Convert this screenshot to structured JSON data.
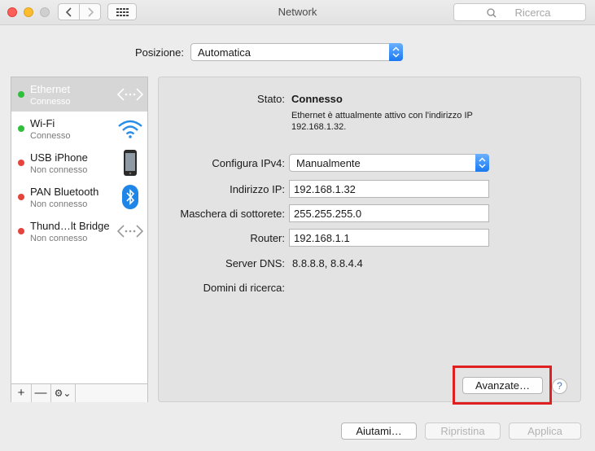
{
  "window": {
    "title": "Network"
  },
  "search": {
    "placeholder": "Ricerca"
  },
  "location": {
    "label": "Posizione:",
    "value": "Automatica"
  },
  "services": [
    {
      "name": "Ethernet",
      "status": "Connesso",
      "status_color": "#2fbf3c",
      "icon": "ethernet-icon",
      "selected": true
    },
    {
      "name": "Wi-Fi",
      "status": "Connesso",
      "status_color": "#2fbf3c",
      "icon": "wifi-icon",
      "selected": false
    },
    {
      "name": "USB iPhone",
      "status": "Non connesso",
      "status_color": "#e4443c",
      "icon": "iphone-icon",
      "selected": false
    },
    {
      "name": "PAN Bluetooth",
      "status": "Non connesso",
      "status_color": "#e4443c",
      "icon": "bluetooth-icon",
      "selected": false
    },
    {
      "name": "Thund…lt Bridge",
      "status": "Non connesso",
      "status_color": "#e4443c",
      "icon": "ethernet-icon",
      "selected": false
    }
  ],
  "sidebar_tools": {
    "add": "+",
    "remove": "—",
    "gear": "⚙︎⌄"
  },
  "details": {
    "status_label": "Stato:",
    "status_value": "Connesso",
    "status_desc_1": "Ethernet è attualmente attivo con l'indirizzo IP",
    "status_desc_2": "192.168.1.32.",
    "ipv4_label": "Configura IPv4:",
    "ipv4_value": "Manualmente",
    "ip_label": "Indirizzo IP:",
    "ip_value": "192.168.1.32",
    "mask_label": "Maschera di sottorete:",
    "mask_value": "255.255.255.0",
    "router_label": "Router:",
    "router_value": "192.168.1.1",
    "dns_label": "Server DNS:",
    "dns_value": "8.8.8.8, 8.8.4.4",
    "search_domains_label": "Domini di ricerca:",
    "advanced_label": "Avanzate…",
    "help_label": "?"
  },
  "footer": {
    "help_label": "Aiutami…",
    "revert_label": "Ripristina",
    "apply_label": "Applica"
  },
  "colors": {
    "highlight": "#e02020",
    "accent": "#1b79f0"
  }
}
